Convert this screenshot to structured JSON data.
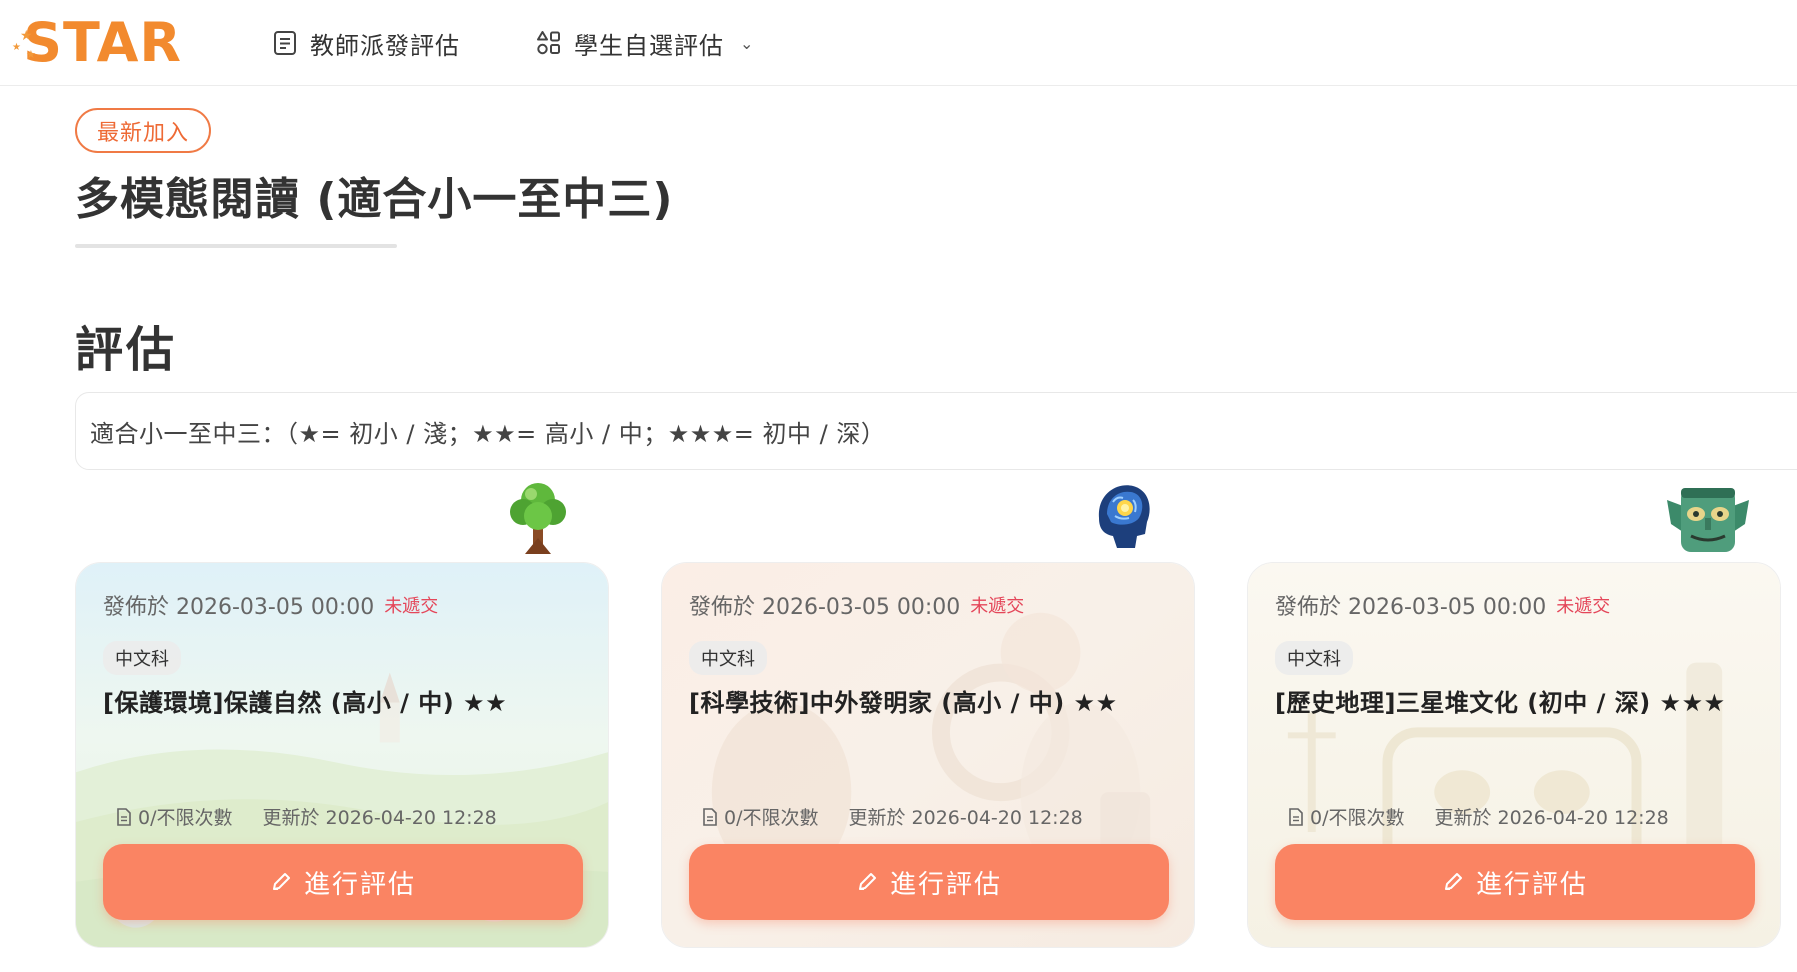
{
  "header": {
    "logo_text": "STAR",
    "nav": [
      {
        "label": "教師派發評估",
        "icon": "document-icon"
      },
      {
        "label": "學生自選評估",
        "icon": "apps-icon",
        "has_dropdown": true
      }
    ]
  },
  "main": {
    "badge": "最新加入",
    "title": "多模態閱讀 (適合小一至中三)",
    "section_title": "評估",
    "hint": "適合小一至中三：（★= 初小 / 淺；★★= 高小 / 中；★★★= 初中 / 深）"
  },
  "cards": [
    {
      "icon": "tree-icon",
      "published": "發佈於 2026-03-05 00:00",
      "status": "未遞交",
      "subject": "中文科",
      "title": "[保護環境]保護自然 (高小 / 中) ★★",
      "attempts": "0/不限次數",
      "updated": "更新於 2026-04-20 12:28",
      "action": "進行評估",
      "accent": "#bfe6f3"
    },
    {
      "icon": "brain-head-icon",
      "published": "發佈於 2026-03-05 00:00",
      "status": "未遞交",
      "subject": "中文科",
      "title": "[科學技術]中外發明家 (高小 / 中) ★★",
      "attempts": "0/不限次數",
      "updated": "更新於 2026-04-20 12:28",
      "action": "進行評估",
      "accent": "#f7e3d6"
    },
    {
      "icon": "bronze-mask-icon",
      "published": "發佈於 2026-03-05 00:00",
      "status": "未遞交",
      "subject": "中文科",
      "title": "[歷史地理]三星堆文化 (初中 / 深) ★★★",
      "attempts": "0/不限次數",
      "updated": "更新於 2026-04-20 12:28",
      "action": "進行評估",
      "accent": "#f4efe2"
    }
  ],
  "colors": {
    "brand": "#f28a2e",
    "button": "#fa8463",
    "status": "#e4475a",
    "badge_border": "#f07a45"
  }
}
